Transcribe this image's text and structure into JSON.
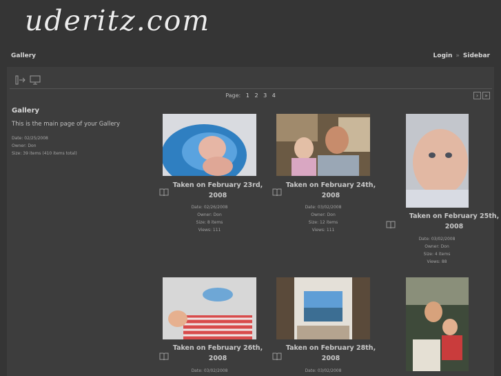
{
  "site": {
    "logo": "uderitz.com"
  },
  "nav": {
    "gallery": "Gallery",
    "login": "Login",
    "separator": "»",
    "sidebar": "Sidebar"
  },
  "pager": {
    "label": "Page:",
    "pages": [
      "1",
      "2",
      "3",
      "4"
    ]
  },
  "gallery_info": {
    "title": "Gallery",
    "description": "This is the main page of your Gallery",
    "date": "Date: 02/25/2008",
    "owner": "Owner: Don",
    "size": "Size: 39 items (410 items total)"
  },
  "items": [
    {
      "title": "Taken on February 23rd, 2008",
      "date": "Date: 02/26/2008",
      "owner": "Owner: Don",
      "size": "Size: 8 items",
      "views": "Views: 111"
    },
    {
      "title": "Taken on February 24th, 2008",
      "date": "Date: 03/02/2008",
      "owner": "Owner: Don",
      "size": "Size: 12 items",
      "views": "Views: 111"
    },
    {
      "title": "Taken on February 25th, 2008",
      "date": "Date: 03/02/2008",
      "owner": "Owner: Don",
      "size": "Size: 4 items",
      "views": "Views: 88"
    },
    {
      "title": "Taken on February 26th, 2008",
      "date": "Date: 03/02/2008"
    },
    {
      "title": "Taken on February 28th, 2008",
      "date": "Date: 03/02/2008"
    }
  ],
  "icons": {
    "sidebar_toggle": "sidebar-toggle-icon",
    "slideshow": "slideshow-icon",
    "album": "album-book-icon",
    "next": "next-page-icon",
    "last": "last-page-icon"
  }
}
